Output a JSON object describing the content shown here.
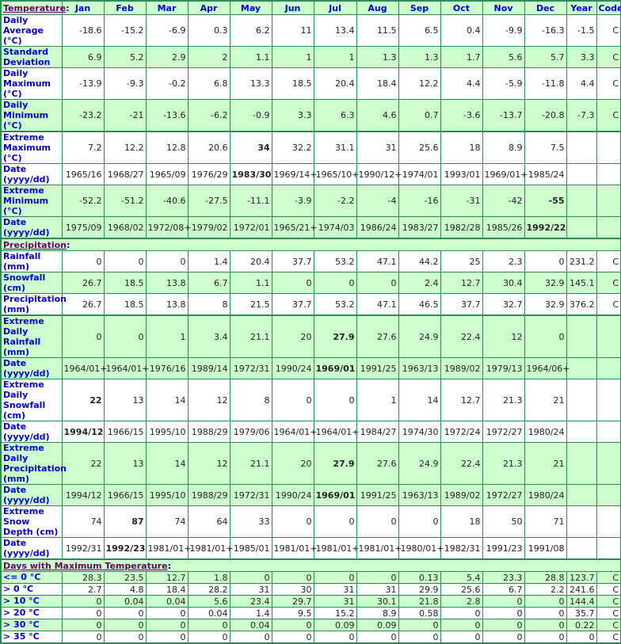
{
  "header": {
    "section_temperature": "Temperature",
    "columns": [
      "Jan",
      "Feb",
      "Mar",
      "Apr",
      "May",
      "Jun",
      "Jul",
      "Aug",
      "Sep",
      "Oct",
      "Nov",
      "Dec",
      "Year",
      "Code"
    ]
  },
  "temperature": {
    "rows": [
      {
        "label": "Daily Average (°C)",
        "values": [
          "-18.6",
          "-15.2",
          "-6.9",
          "0.3",
          "6.2",
          "11",
          "13.4",
          "11.5",
          "6.5",
          "0.4",
          "-9.9",
          "-16.3",
          "-1.5",
          "C"
        ],
        "bold": []
      },
      {
        "label": "Standard Deviation",
        "values": [
          "6.9",
          "5.2",
          "2.9",
          "2",
          "1.1",
          "1",
          "1",
          "1.3",
          "1.3",
          "1.7",
          "5.6",
          "5.7",
          "3.3",
          "C"
        ],
        "bold": []
      },
      {
        "label": "Daily Maximum (°C)",
        "values": [
          "-13.9",
          "-9.3",
          "-0.2",
          "6.8",
          "13.3",
          "18.5",
          "20.4",
          "18.4",
          "12.2",
          "4.4",
          "-5.9",
          "-11.8",
          "4.4",
          "C"
        ],
        "bold": []
      },
      {
        "label": "Daily Minimum (°C)",
        "values": [
          "-23.2",
          "-21",
          "-13.6",
          "-6.2",
          "-0.9",
          "3.3",
          "6.3",
          "4.6",
          "0.7",
          "-3.6",
          "-13.7",
          "-20.8",
          "-7.3",
          "C"
        ],
        "bold": []
      },
      {
        "label": "Extreme Maximum (°C)",
        "values": [
          "7.2",
          "12.2",
          "12.8",
          "20.6",
          "34",
          "32.2",
          "31.1",
          "31",
          "25.6",
          "18",
          "8.9",
          "7.5",
          "",
          ""
        ],
        "bold": [
          4
        ]
      },
      {
        "label": "Date (yyyy/dd)",
        "values": [
          "1965/16",
          "1968/27",
          "1965/09",
          "1976/29",
          "1983/30",
          "1969/14+",
          "1965/10+",
          "1990/12+",
          "1974/01",
          "1993/01",
          "1969/01+",
          "1985/24",
          "",
          ""
        ],
        "bold": [
          4
        ]
      },
      {
        "label": "Extreme Minimum (°C)",
        "values": [
          "-52.2",
          "-51.2",
          "-40.6",
          "-27.5",
          "-11.1",
          "-3.9",
          "-2.2",
          "-4",
          "-16",
          "-31",
          "-42",
          "-55",
          "",
          ""
        ],
        "bold": [
          11
        ]
      },
      {
        "label": "Date (yyyy/dd)",
        "values": [
          "1975/09",
          "1968/02",
          "1972/08+",
          "1979/02",
          "1972/01",
          "1965/21+",
          "1974/03",
          "1986/24",
          "1983/27",
          "1982/28",
          "1985/26",
          "1992/22",
          "",
          ""
        ],
        "bold": [
          11
        ]
      }
    ]
  },
  "precipitation": {
    "section_label": "Precipitation",
    "rows": [
      {
        "label": "Rainfall (mm)",
        "values": [
          "0",
          "0",
          "0",
          "1.4",
          "20.4",
          "37.7",
          "53.2",
          "47.1",
          "44.2",
          "25",
          "2.3",
          "0",
          "231.2",
          "C"
        ],
        "bold": []
      },
      {
        "label": "Snowfall (cm)",
        "values": [
          "26.7",
          "18.5",
          "13.8",
          "6.7",
          "1.1",
          "0",
          "0",
          "0",
          "2.4",
          "12.7",
          "30.4",
          "32.9",
          "145.1",
          "C"
        ],
        "bold": []
      },
      {
        "label": "Precipitation (mm)",
        "values": [
          "26.7",
          "18.5",
          "13.8",
          "8",
          "21.5",
          "37.7",
          "53.2",
          "47.1",
          "46.5",
          "37.7",
          "32.7",
          "32.9",
          "376.2",
          "C"
        ],
        "bold": []
      },
      {
        "label": "Extreme Daily Rainfall (mm)",
        "values": [
          "0",
          "0",
          "1",
          "3.4",
          "21.1",
          "20",
          "27.9",
          "27.6",
          "24.9",
          "22.4",
          "12",
          "0",
          "",
          ""
        ],
        "bold": [
          6
        ]
      },
      {
        "label": "Date (yyyy/dd)",
        "values": [
          "1964/01+",
          "1964/01+",
          "1976/16",
          "1989/14",
          "1972/31",
          "1990/24",
          "1969/01",
          "1991/25",
          "1963/13",
          "1989/02",
          "1979/13",
          "1964/06+",
          "",
          ""
        ],
        "bold": [
          6
        ]
      },
      {
        "label": "Extreme Daily Snowfall (cm)",
        "values": [
          "22",
          "13",
          "14",
          "12",
          "8",
          "0",
          "0",
          "1",
          "14",
          "12.7",
          "21.3",
          "21",
          "",
          ""
        ],
        "bold": [
          0
        ]
      },
      {
        "label": "Date (yyyy/dd)",
        "values": [
          "1994/12",
          "1966/15",
          "1995/10",
          "1988/29",
          "1979/06",
          "1964/01+",
          "1964/01+",
          "1984/27",
          "1974/30",
          "1972/24",
          "1972/27",
          "1980/24",
          "",
          ""
        ],
        "bold": [
          0
        ]
      },
      {
        "label": "Extreme Daily Precipitation (mm)",
        "values": [
          "22",
          "13",
          "14",
          "12",
          "21.1",
          "20",
          "27.9",
          "27.6",
          "24.9",
          "22.4",
          "21.3",
          "21",
          "",
          ""
        ],
        "bold": [
          6
        ]
      },
      {
        "label": "Date (yyyy/dd)",
        "values": [
          "1994/12",
          "1966/15",
          "1995/10",
          "1988/29",
          "1972/31",
          "1990/24",
          "1969/01",
          "1991/25",
          "1963/13",
          "1989/02",
          "1972/27",
          "1980/24",
          "",
          ""
        ],
        "bold": [
          6
        ]
      },
      {
        "label": "Extreme Snow Depth (cm)",
        "values": [
          "74",
          "87",
          "74",
          "64",
          "33",
          "0",
          "0",
          "0",
          "0",
          "18",
          "50",
          "71",
          "",
          ""
        ],
        "bold": [
          1
        ]
      },
      {
        "label": "Date (yyyy/dd)",
        "values": [
          "1992/31",
          "1992/23",
          "1981/01+",
          "1981/01+",
          "1985/01",
          "1981/01+",
          "1981/01+",
          "1981/01+",
          "1980/01+",
          "1982/31",
          "1991/23",
          "1991/08",
          "",
          ""
        ],
        "bold": [
          1
        ]
      }
    ]
  },
  "days_max_temp": {
    "section_label": "Days with Maximum Temperature",
    "rows": [
      {
        "label": "<= 0 °C",
        "values": [
          "28.3",
          "23.5",
          "12.7",
          "1.8",
          "0",
          "0",
          "0",
          "0",
          "0.13",
          "5.4",
          "23.3",
          "28.8",
          "123.7",
          "C"
        ],
        "bold": []
      },
      {
        "label": "> 0 °C",
        "values": [
          "2.7",
          "4.8",
          "18.4",
          "28.2",
          "31",
          "30",
          "31",
          "31",
          "29.9",
          "25.6",
          "6.7",
          "2.2",
          "241.6",
          "C"
        ],
        "bold": []
      },
      {
        "label": "> 10 °C",
        "values": [
          "0",
          "0.04",
          "0.04",
          "5.6",
          "23.4",
          "29.7",
          "31",
          "30.1",
          "21.8",
          "2.8",
          "0",
          "0",
          "144.4",
          "C"
        ],
        "bold": []
      },
      {
        "label": "> 20 °C",
        "values": [
          "0",
          "0",
          "0",
          "0.04",
          "1.4",
          "9.5",
          "15.2",
          "8.9",
          "0.58",
          "0",
          "0",
          "0",
          "35.7",
          "C"
        ],
        "bold": []
      },
      {
        "label": "> 30 °C",
        "values": [
          "0",
          "0",
          "0",
          "0",
          "0.04",
          "0",
          "0.09",
          "0.09",
          "0",
          "0",
          "0",
          "0",
          "0.22",
          "C"
        ],
        "bold": []
      },
      {
        "label": "> 35 °C",
        "values": [
          "0",
          "0",
          "0",
          "0",
          "0",
          "0",
          "0",
          "0",
          "0",
          "0",
          "0",
          "0",
          "0",
          "C"
        ],
        "bold": []
      }
    ]
  }
}
